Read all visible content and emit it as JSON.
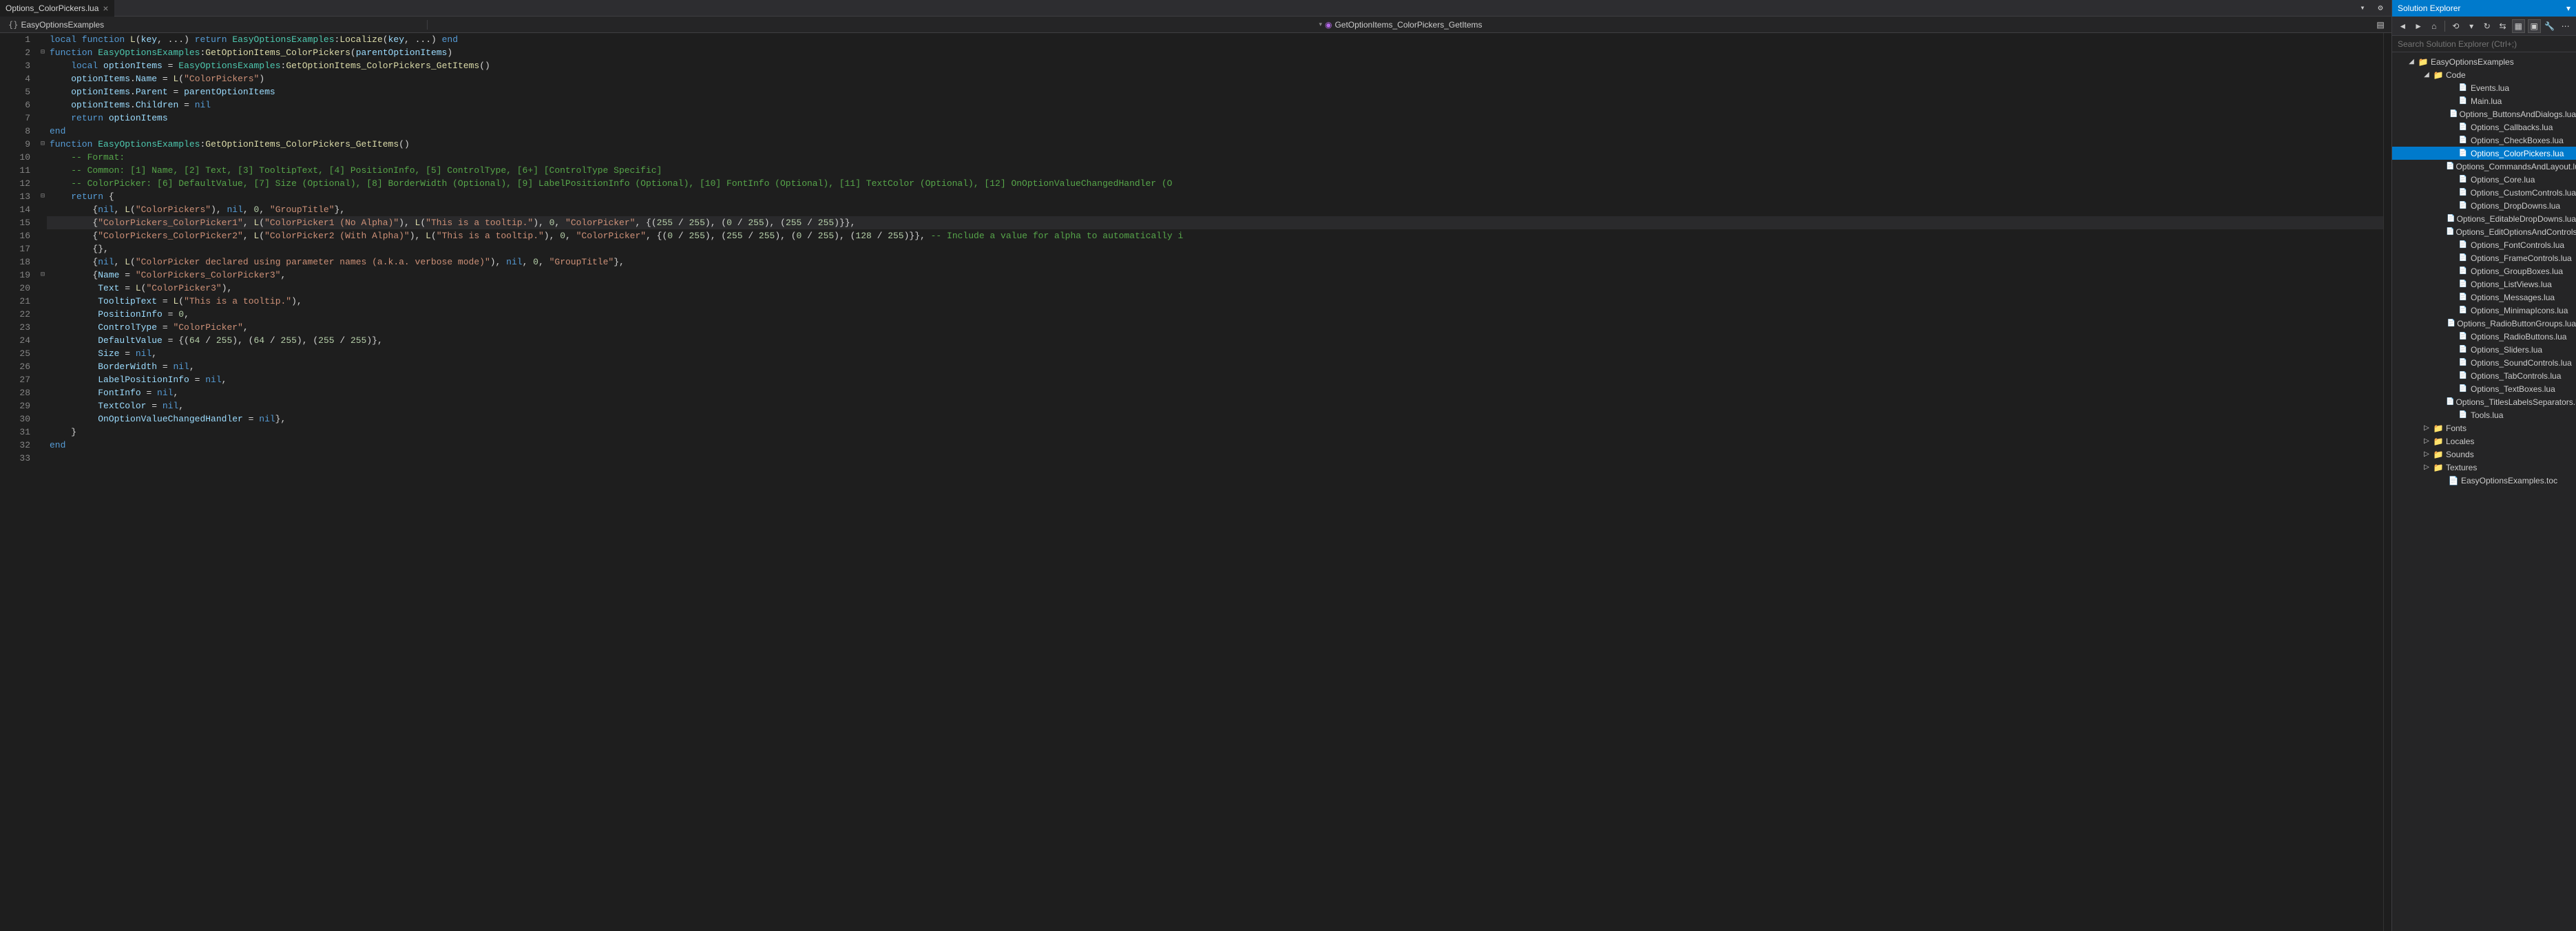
{
  "tab": {
    "name": "Options_ColorPickers.lua"
  },
  "nav": {
    "left": "EasyOptionsExamples",
    "center": "GetOptionItems_ColorPickers_GetItems"
  },
  "explorer": {
    "title": "Solution Explorer",
    "search_placeholder": "Search Solution Explorer (Ctrl+;)",
    "project": "EasyOptionsExamples",
    "codeFolder": "Code",
    "files": [
      "Events.lua",
      "Main.lua",
      "Options_ButtonsAndDialogs.lua",
      "Options_Callbacks.lua",
      "Options_CheckBoxes.lua",
      "Options_ColorPickers.lua",
      "Options_CommandsAndLayout.lua",
      "Options_Core.lua",
      "Options_CustomControls.lua",
      "Options_DropDowns.lua",
      "Options_EditableDropDowns.lua",
      "Options_EditOptionsAndControls.lua",
      "Options_FontControls.lua",
      "Options_FrameControls.lua",
      "Options_GroupBoxes.lua",
      "Options_ListViews.lua",
      "Options_Messages.lua",
      "Options_MinimapIcons.lua",
      "Options_RadioButtonGroups.lua",
      "Options_RadioButtons.lua",
      "Options_Sliders.lua",
      "Options_SoundControls.lua",
      "Options_TabControls.lua",
      "Options_TextBoxes.lua",
      "Options_TitlesLabelsSeparators.lua",
      "Tools.lua"
    ],
    "folders": [
      "Fonts",
      "Locales",
      "Sounds",
      "Textures"
    ],
    "toc": "EasyOptionsExamples.toc"
  },
  "code": {
    "lines": [
      {
        "n": 1,
        "f": "",
        "t": [
          [
            "kw",
            "local function"
          ],
          [
            "op",
            " "
          ],
          [
            "fn",
            "L"
          ],
          [
            "op",
            "("
          ],
          [
            "nm",
            "key"
          ],
          [
            "op",
            ", ..."
          ],
          [
            "op",
            ") "
          ],
          [
            "kw",
            "return"
          ],
          [
            "op",
            " "
          ],
          [
            "ty",
            "EasyOptionsExamples"
          ],
          [
            "op",
            ":"
          ],
          [
            "fn",
            "Localize"
          ],
          [
            "op",
            "("
          ],
          [
            "nm",
            "key"
          ],
          [
            "op",
            ", ..."
          ],
          [
            "op",
            ") "
          ],
          [
            "kw",
            "end"
          ]
        ]
      },
      {
        "n": 2,
        "f": "⊟",
        "t": [
          [
            "kw",
            "function"
          ],
          [
            "op",
            " "
          ],
          [
            "ty",
            "EasyOptionsExamples"
          ],
          [
            "op",
            ":"
          ],
          [
            "fn",
            "GetOptionItems_ColorPickers"
          ],
          [
            "op",
            "("
          ],
          [
            "nm",
            "parentOptionItems"
          ],
          [
            "op",
            ")"
          ]
        ]
      },
      {
        "n": 3,
        "f": "",
        "t": [
          [
            "op",
            "    "
          ],
          [
            "kw",
            "local"
          ],
          [
            "op",
            " "
          ],
          [
            "nm",
            "optionItems"
          ],
          [
            "op",
            " = "
          ],
          [
            "ty",
            "EasyOptionsExamples"
          ],
          [
            "op",
            ":"
          ],
          [
            "fn",
            "GetOptionItems_ColorPickers_GetItems"
          ],
          [
            "op",
            "()"
          ]
        ]
      },
      {
        "n": 4,
        "f": "",
        "t": [
          [
            "op",
            "    "
          ],
          [
            "nm",
            "optionItems"
          ],
          [
            "op",
            "."
          ],
          [
            "nm",
            "Name"
          ],
          [
            "op",
            " = "
          ],
          [
            "fn",
            "L"
          ],
          [
            "op",
            "("
          ],
          [
            "str",
            "\"ColorPickers\""
          ],
          [
            "op",
            ")"
          ]
        ]
      },
      {
        "n": 5,
        "f": "",
        "t": [
          [
            "op",
            "    "
          ],
          [
            "nm",
            "optionItems"
          ],
          [
            "op",
            "."
          ],
          [
            "nm",
            "Parent"
          ],
          [
            "op",
            " = "
          ],
          [
            "nm",
            "parentOptionItems"
          ]
        ]
      },
      {
        "n": 6,
        "f": "",
        "t": [
          [
            "op",
            "    "
          ],
          [
            "nm",
            "optionItems"
          ],
          [
            "op",
            "."
          ],
          [
            "nm",
            "Children"
          ],
          [
            "op",
            " = "
          ],
          [
            "kw",
            "nil"
          ]
        ]
      },
      {
        "n": 7,
        "f": "",
        "t": [
          [
            "op",
            "    "
          ],
          [
            "kw",
            "return"
          ],
          [
            "op",
            " "
          ],
          [
            "nm",
            "optionItems"
          ]
        ]
      },
      {
        "n": 8,
        "f": "",
        "t": [
          [
            "kw",
            "end"
          ]
        ]
      },
      {
        "n": 9,
        "f": "⊟",
        "t": [
          [
            "kw",
            "function"
          ],
          [
            "op",
            " "
          ],
          [
            "ty",
            "EasyOptionsExamples"
          ],
          [
            "op",
            ":"
          ],
          [
            "fn",
            "GetOptionItems_ColorPickers_GetItems"
          ],
          [
            "op",
            "()"
          ]
        ]
      },
      {
        "n": 10,
        "f": "",
        "t": [
          [
            "op",
            "    "
          ],
          [
            "cmt",
            "-- Format:"
          ]
        ]
      },
      {
        "n": 11,
        "f": "",
        "t": [
          [
            "op",
            "    "
          ],
          [
            "cmt",
            "-- Common: [1] Name, [2] Text, [3] TooltipText, [4] PositionInfo, [5] ControlType, [6+] [ControlType Specific]"
          ]
        ]
      },
      {
        "n": 12,
        "f": "",
        "t": [
          [
            "op",
            "    "
          ],
          [
            "cmt",
            "-- ColorPicker: [6] DefaultValue, [7] Size (Optional), [8] BorderWidth (Optional), [9] LabelPositionInfo (Optional), [10] FontInfo (Optional), [11] TextColor (Optional), [12] OnOptionValueChangedHandler (O"
          ]
        ]
      },
      {
        "n": 13,
        "f": "⊟",
        "t": [
          [
            "op",
            "    "
          ],
          [
            "kw",
            "return"
          ],
          [
            "op",
            " {"
          ]
        ]
      },
      {
        "n": 14,
        "f": "",
        "t": [
          [
            "op",
            "        {"
          ],
          [
            "kw",
            "nil"
          ],
          [
            "op",
            ", "
          ],
          [
            "fn",
            "L"
          ],
          [
            "op",
            "("
          ],
          [
            "str",
            "\"ColorPickers\""
          ],
          [
            "op",
            "), "
          ],
          [
            "kw",
            "nil"
          ],
          [
            "op",
            ", "
          ],
          [
            "num",
            "0"
          ],
          [
            "op",
            ", "
          ],
          [
            "str",
            "\"GroupTitle\""
          ],
          [
            "op",
            "},"
          ]
        ]
      },
      {
        "n": 15,
        "f": "",
        "hl": true,
        "t": [
          [
            "op",
            "        {"
          ],
          [
            "str",
            "\"ColorPickers_ColorPicker1\""
          ],
          [
            "op",
            ", "
          ],
          [
            "fn",
            "L"
          ],
          [
            "op",
            "("
          ],
          [
            "str",
            "\"ColorPicker1 (No Alpha)\""
          ],
          [
            "op",
            "), "
          ],
          [
            "fn",
            "L"
          ],
          [
            "op",
            "("
          ],
          [
            "str",
            "\"This is a tooltip.\""
          ],
          [
            "op",
            "), "
          ],
          [
            "num",
            "0"
          ],
          [
            "op",
            ", "
          ],
          [
            "str",
            "\"ColorPicker\""
          ],
          [
            "op",
            ", {("
          ],
          [
            "num",
            "255"
          ],
          [
            "op",
            " / "
          ],
          [
            "num",
            "255"
          ],
          [
            "op",
            "), ("
          ],
          [
            "num",
            "0"
          ],
          [
            "op",
            " / "
          ],
          [
            "num",
            "255"
          ],
          [
            "op",
            "), ("
          ],
          [
            "num",
            "255"
          ],
          [
            "op",
            " / "
          ],
          [
            "num",
            "255"
          ],
          [
            "op",
            ")}},"
          ]
        ]
      },
      {
        "n": 16,
        "f": "",
        "t": [
          [
            "op",
            "        {"
          ],
          [
            "str",
            "\"ColorPickers_ColorPicker2\""
          ],
          [
            "op",
            ", "
          ],
          [
            "fn",
            "L"
          ],
          [
            "op",
            "("
          ],
          [
            "str",
            "\"ColorPicker2 (With Alpha)\""
          ],
          [
            "op",
            "), "
          ],
          [
            "fn",
            "L"
          ],
          [
            "op",
            "("
          ],
          [
            "str",
            "\"This is a tooltip.\""
          ],
          [
            "op",
            "), "
          ],
          [
            "num",
            "0"
          ],
          [
            "op",
            ", "
          ],
          [
            "str",
            "\"ColorPicker\""
          ],
          [
            "op",
            ", {("
          ],
          [
            "num",
            "0"
          ],
          [
            "op",
            " / "
          ],
          [
            "num",
            "255"
          ],
          [
            "op",
            "), ("
          ],
          [
            "num",
            "255"
          ],
          [
            "op",
            " / "
          ],
          [
            "num",
            "255"
          ],
          [
            "op",
            "), ("
          ],
          [
            "num",
            "0"
          ],
          [
            "op",
            " / "
          ],
          [
            "num",
            "255"
          ],
          [
            "op",
            "), ("
          ],
          [
            "num",
            "128"
          ],
          [
            "op",
            " / "
          ],
          [
            "num",
            "255"
          ],
          [
            "op",
            ")}}, "
          ],
          [
            "cmt",
            "-- Include a value for alpha to automatically i"
          ]
        ]
      },
      {
        "n": 17,
        "f": "",
        "t": [
          [
            "op",
            "        {},"
          ]
        ]
      },
      {
        "n": 18,
        "f": "",
        "t": [
          [
            "op",
            "        {"
          ],
          [
            "kw",
            "nil"
          ],
          [
            "op",
            ", "
          ],
          [
            "fn",
            "L"
          ],
          [
            "op",
            "("
          ],
          [
            "str",
            "\"ColorPicker declared using parameter names (a.k.a. verbose mode)\""
          ],
          [
            "op",
            "), "
          ],
          [
            "kw",
            "nil"
          ],
          [
            "op",
            ", "
          ],
          [
            "num",
            "0"
          ],
          [
            "op",
            ", "
          ],
          [
            "str",
            "\"GroupTitle\""
          ],
          [
            "op",
            "},"
          ]
        ]
      },
      {
        "n": 19,
        "f": "⊟",
        "t": [
          [
            "op",
            "        {"
          ],
          [
            "nm",
            "Name"
          ],
          [
            "op",
            " = "
          ],
          [
            "str",
            "\"ColorPickers_ColorPicker3\""
          ],
          [
            "op",
            ","
          ]
        ]
      },
      {
        "n": 20,
        "f": "",
        "t": [
          [
            "op",
            "         "
          ],
          [
            "nm",
            "Text"
          ],
          [
            "op",
            " = "
          ],
          [
            "fn",
            "L"
          ],
          [
            "op",
            "("
          ],
          [
            "str",
            "\"ColorPicker3\""
          ],
          [
            "op",
            "),"
          ]
        ]
      },
      {
        "n": 21,
        "f": "",
        "t": [
          [
            "op",
            "         "
          ],
          [
            "nm",
            "TooltipText"
          ],
          [
            "op",
            " = "
          ],
          [
            "fn",
            "L"
          ],
          [
            "op",
            "("
          ],
          [
            "str",
            "\"This is a tooltip.\""
          ],
          [
            "op",
            "),"
          ]
        ]
      },
      {
        "n": 22,
        "f": "",
        "t": [
          [
            "op",
            "         "
          ],
          [
            "nm",
            "PositionInfo"
          ],
          [
            "op",
            " = "
          ],
          [
            "num",
            "0"
          ],
          [
            "op",
            ","
          ]
        ]
      },
      {
        "n": 23,
        "f": "",
        "t": [
          [
            "op",
            "         "
          ],
          [
            "nm",
            "ControlType"
          ],
          [
            "op",
            " = "
          ],
          [
            "str",
            "\"ColorPicker\""
          ],
          [
            "op",
            ","
          ]
        ]
      },
      {
        "n": 24,
        "f": "",
        "t": [
          [
            "op",
            "         "
          ],
          [
            "nm",
            "DefaultValue"
          ],
          [
            "op",
            " = {("
          ],
          [
            "num",
            "64"
          ],
          [
            "op",
            " / "
          ],
          [
            "num",
            "255"
          ],
          [
            "op",
            "), ("
          ],
          [
            "num",
            "64"
          ],
          [
            "op",
            " / "
          ],
          [
            "num",
            "255"
          ],
          [
            "op",
            "), ("
          ],
          [
            "num",
            "255"
          ],
          [
            "op",
            " / "
          ],
          [
            "num",
            "255"
          ],
          [
            "op",
            ")},"
          ]
        ]
      },
      {
        "n": 25,
        "f": "",
        "t": [
          [
            "op",
            "         "
          ],
          [
            "nm",
            "Size"
          ],
          [
            "op",
            " = "
          ],
          [
            "kw",
            "nil"
          ],
          [
            "op",
            ","
          ]
        ]
      },
      {
        "n": 26,
        "f": "",
        "t": [
          [
            "op",
            "         "
          ],
          [
            "nm",
            "BorderWidth"
          ],
          [
            "op",
            " = "
          ],
          [
            "kw",
            "nil"
          ],
          [
            "op",
            ","
          ]
        ]
      },
      {
        "n": 27,
        "f": "",
        "t": [
          [
            "op",
            "         "
          ],
          [
            "nm",
            "LabelPositionInfo"
          ],
          [
            "op",
            " = "
          ],
          [
            "kw",
            "nil"
          ],
          [
            "op",
            ","
          ]
        ]
      },
      {
        "n": 28,
        "f": "",
        "t": [
          [
            "op",
            "         "
          ],
          [
            "nm",
            "FontInfo"
          ],
          [
            "op",
            " = "
          ],
          [
            "kw",
            "nil"
          ],
          [
            "op",
            ","
          ]
        ]
      },
      {
        "n": 29,
        "f": "",
        "t": [
          [
            "op",
            "         "
          ],
          [
            "nm",
            "TextColor"
          ],
          [
            "op",
            " = "
          ],
          [
            "kw",
            "nil"
          ],
          [
            "op",
            ","
          ]
        ]
      },
      {
        "n": 30,
        "f": "",
        "t": [
          [
            "op",
            "         "
          ],
          [
            "nm",
            "OnOptionValueChangedHandler"
          ],
          [
            "op",
            " = "
          ],
          [
            "kw",
            "nil"
          ],
          [
            "op",
            "},"
          ]
        ]
      },
      {
        "n": 31,
        "f": "",
        "t": [
          [
            "op",
            "    }"
          ]
        ]
      },
      {
        "n": 32,
        "f": "",
        "t": [
          [
            "kw",
            "end"
          ]
        ]
      },
      {
        "n": 33,
        "f": "",
        "t": [
          [
            "op",
            ""
          ]
        ]
      }
    ]
  }
}
